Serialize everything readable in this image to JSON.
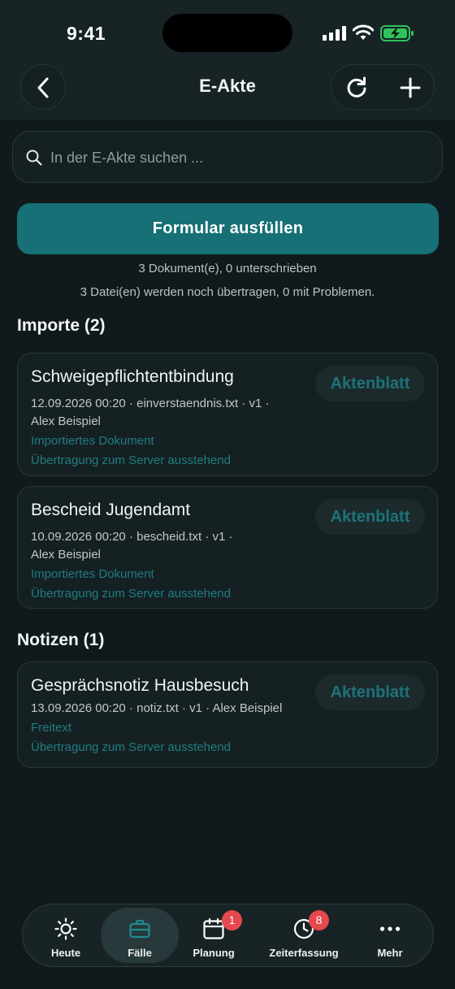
{
  "status_bar": {
    "time": "9:41"
  },
  "header": {
    "title": "E-Akte",
    "back_icon": "chevron-left-icon",
    "reload_icon": "refresh-icon",
    "add_icon": "plus-icon"
  },
  "search": {
    "placeholder": "In der E-Akte suchen ...",
    "value": ""
  },
  "primary_button": {
    "label": "Formular ausfüllen"
  },
  "summary": {
    "documents": "3 Dokument(e), 0 unterschrieben",
    "transfers": "3 Datei(en) werden noch übertragen, 0 mit Problemen."
  },
  "sections": [
    {
      "heading": "Importe (2)",
      "items": [
        {
          "title": "Schweigepflichtentbindung",
          "meta_line1": "12.09.2026 00:20 · einverstaendnis.txt · v1 ·",
          "meta_line2": "Alex Beispiel",
          "type": "Importiertes Dokument",
          "status": "Übertragung zum Server ausstehend",
          "action": "Aktenblatt"
        },
        {
          "title": "Bescheid Jugendamt",
          "meta_line1": "10.09.2026 00:20 · bescheid.txt · v1 ·",
          "meta_line2": "Alex Beispiel",
          "type": "Importiertes Dokument",
          "status": "Übertragung zum Server ausstehend",
          "action": "Aktenblatt"
        }
      ]
    },
    {
      "heading": "Notizen (1)",
      "items": [
        {
          "title": "Gesprächsnotiz Hausbesuch",
          "meta_line1": "13.09.2026 00:20 · notiz.txt · v1 · Alex Beispiel",
          "type": "Freitext",
          "status": "Übertragung zum Server ausstehend",
          "action": "Aktenblatt"
        }
      ]
    }
  ],
  "tabbar": {
    "items": [
      {
        "label": "Heute",
        "icon": "sun-icon",
        "active": false
      },
      {
        "label": "Fälle",
        "icon": "briefcase-icon",
        "active": true
      },
      {
        "label": "Planung",
        "icon": "calendar-icon",
        "badge": "1"
      },
      {
        "label": "Zeiterfassung",
        "icon": "clock-icon",
        "badge": "8"
      },
      {
        "label": "Mehr",
        "icon": "more-icon"
      }
    ]
  },
  "colors": {
    "background": "#101a1c",
    "accent": "#167076",
    "link": "#1f7d83",
    "badge": "#e5484d"
  }
}
